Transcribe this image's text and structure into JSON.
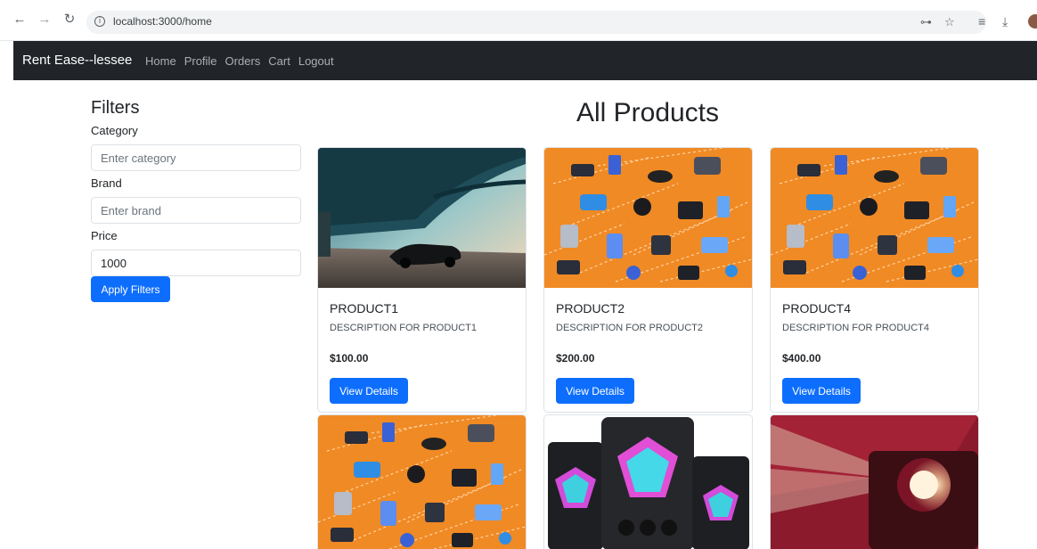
{
  "browser": {
    "url": "localhost:3000/home",
    "icons": [
      "back-arrow-icon",
      "forward-arrow-icon",
      "reload-icon",
      "info-icon",
      "password-key-icon",
      "star-icon",
      "reading-list-icon",
      "download-icon"
    ]
  },
  "navbar": {
    "brand": "Rent Ease--lessee",
    "links": [
      "Home",
      "Profile",
      "Orders",
      "Cart",
      "Logout"
    ]
  },
  "filters": {
    "title": "Filters",
    "category_label": "Category",
    "category_placeholder": "Enter category",
    "brand_label": "Brand",
    "brand_placeholder": "Enter brand",
    "price_label": "Price",
    "price_value": "1000",
    "apply_label": "Apply Filters"
  },
  "main": {
    "title": "All Products",
    "products": [
      {
        "name": "PRODUCT1",
        "description": "DESCRIPTION FOR PRODUCT1",
        "price": "$100.00",
        "button": "View Details"
      },
      {
        "name": "PRODUCT2",
        "description": "DESCRIPTION FOR PRODUCT2",
        "price": "$200.00",
        "button": "View Details"
      },
      {
        "name": "PRODUCT4",
        "description": "DESCRIPTION FOR PRODUCT4",
        "price": "$400.00",
        "button": "View Details"
      }
    ]
  },
  "colors": {
    "primary": "#0d6efd",
    "navbar_bg": "#212529",
    "gadget_orange": "#f08a24"
  }
}
